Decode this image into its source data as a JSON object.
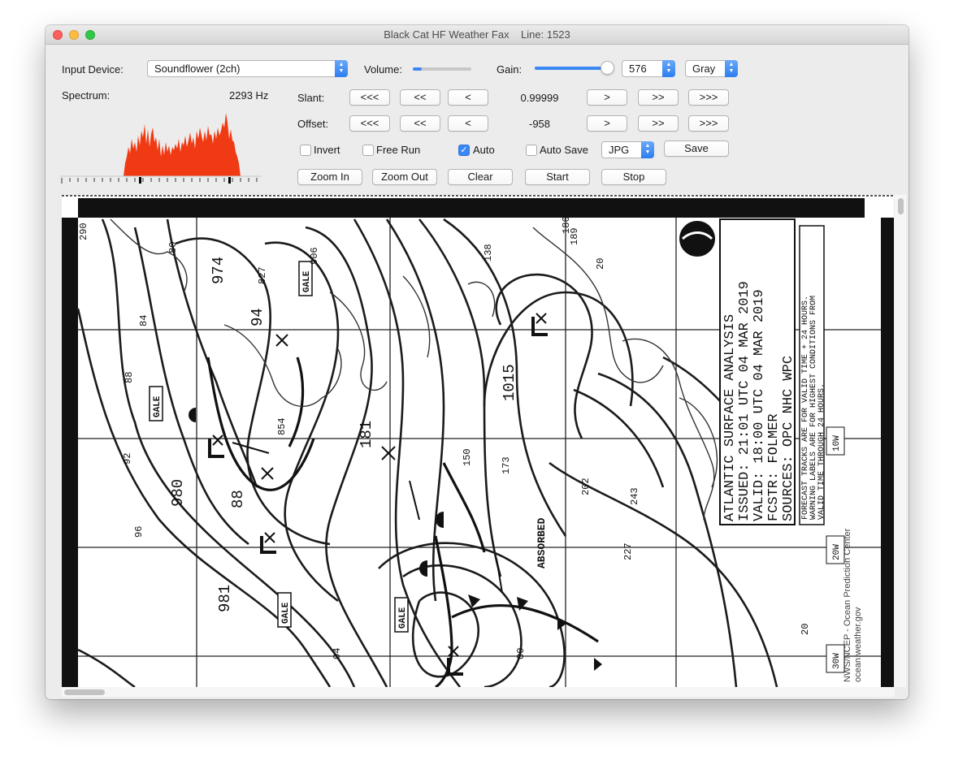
{
  "window": {
    "title": "Black Cat HF Weather Fax",
    "line_label": "Line: 1523"
  },
  "input_device": {
    "label": "Input Device:",
    "value": "Soundflower (2ch)"
  },
  "volume": {
    "label": "Volume:",
    "level": 0.15
  },
  "gain": {
    "label": "Gain:",
    "level": 0.93,
    "value": "576",
    "color_mode": "Gray"
  },
  "spectrum": {
    "label": "Spectrum:",
    "frequency": "2293 Hz"
  },
  "slant": {
    "label": "Slant:",
    "value": "0.99999",
    "b1": "<<<",
    "b2": "<<",
    "b3": "<",
    "b4": ">",
    "b5": ">>",
    "b6": ">>>"
  },
  "offset": {
    "label": "Offset:",
    "value": "-958",
    "b1": "<<<",
    "b2": "<<",
    "b3": "<",
    "b4": ">",
    "b5": ">>",
    "b6": ">>>"
  },
  "options": {
    "invert": "Invert",
    "invert_checked": false,
    "free_run": "Free Run",
    "free_run_checked": false,
    "auto": "Auto",
    "auto_checked": true,
    "auto_save": "Auto Save",
    "auto_save_checked": false,
    "format": "JPG",
    "save": "Save"
  },
  "actions": {
    "zoom_in": "Zoom In",
    "zoom_out": "Zoom Out",
    "clear": "Clear",
    "start": "Start",
    "stop": "Stop"
  },
  "fax": {
    "title_block": [
      "ATLANTIC SURFACE ANALYSIS",
      "ISSUED: 21:01 UTC 04 MAR 2019",
      "VALID:  18:00 UTC 04 MAR 2019",
      "FCSTR:  FOLMER",
      "SOURCES: OPC NHC WPC"
    ],
    "note": [
      "FORECAST TRACKS ARE FOR VALID TIME + 24 HOURS.",
      "WARNING LABELS ARE FOR HIGHEST CONDITIONS FROM",
      "VALID TIME THROUGH 24 HOURS."
    ],
    "credit": [
      "NWS/NCEP - Ocean Prediction Center",
      "ocean.weather.gov"
    ],
    "gale": "GALE",
    "absorbed": "ABSORBED",
    "pressures": {
      "p974": "974",
      "p980": "980",
      "p981": "981",
      "p1015": "1015",
      "p94": "94",
      "p88": "88",
      "p181": "181"
    },
    "small_numbers": {
      "n80": "80",
      "n84": "84",
      "n88": "88",
      "n92": "92",
      "n96": "96",
      "n150": "150",
      "n173": "173",
      "n202": "202",
      "n243": "243",
      "n227": "227",
      "n138": "138",
      "n186": "186",
      "n189": "189",
      "n854": "854",
      "n906": "906",
      "n827": "827",
      "n290": "290",
      "n04": "04",
      "n00": "00",
      "n20": "20"
    },
    "longitudes": {
      "w10": "10W",
      "w20": "20W",
      "w30": "30W"
    }
  }
}
